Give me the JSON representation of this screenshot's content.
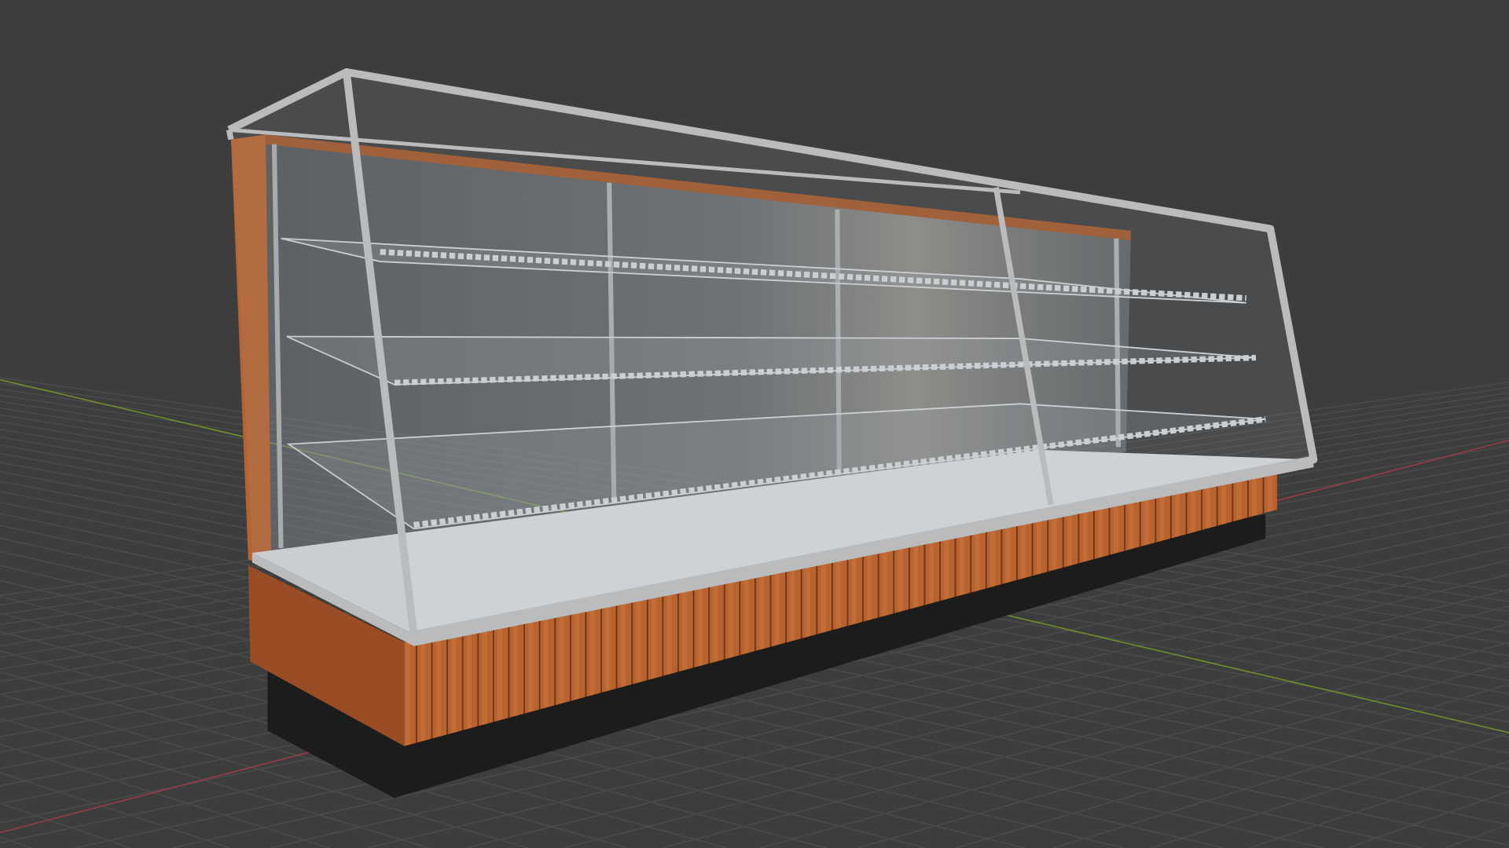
{
  "colors": {
    "background": "#3d3d3d",
    "grid": "#4a4a4a",
    "axis_x": "#9a3c48",
    "axis_y": "#6f8f2a",
    "wood": "#b8622f",
    "wood_dark": "#8a4220",
    "plinth": "#1c1c1c",
    "counter": "#d4d6d9",
    "frame": "#b9bbbd",
    "glass": "#8a9499",
    "shelf": "#cfd3d6"
  }
}
